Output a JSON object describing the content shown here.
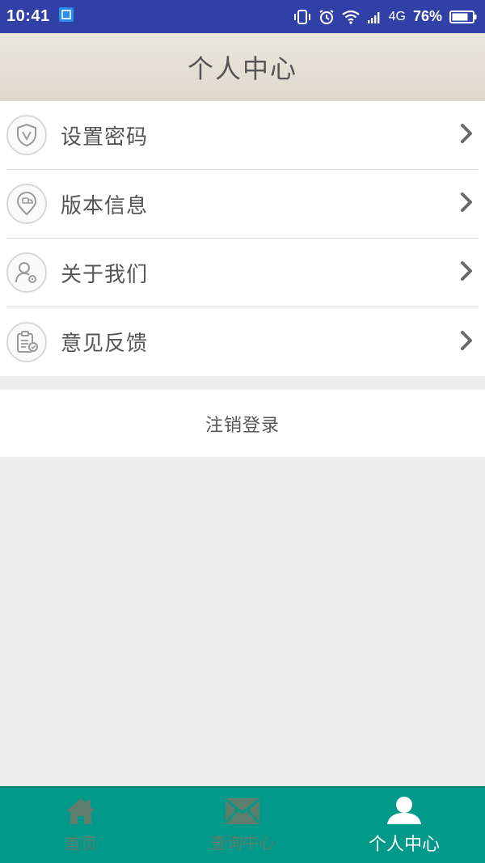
{
  "status_bar": {
    "time": "10:41",
    "network": "4G",
    "battery": "76%"
  },
  "header": {
    "title": "个人中心"
  },
  "menu": {
    "items": [
      {
        "label": "设置密码",
        "icon": "shield-icon"
      },
      {
        "label": "版本信息",
        "icon": "location-pin-icon"
      },
      {
        "label": "关于我们",
        "icon": "user-settings-icon"
      },
      {
        "label": "意见反馈",
        "icon": "clipboard-icon"
      }
    ]
  },
  "logout": {
    "label": "注销登录"
  },
  "tabbar": {
    "tabs": [
      {
        "label": "首页",
        "icon": "home-icon",
        "active": false
      },
      {
        "label": "查询中心",
        "icon": "envelope-icon",
        "active": false
      },
      {
        "label": "个人中心",
        "icon": "person-icon",
        "active": true
      }
    ]
  },
  "colors": {
    "status_bar_bg": "#3040a6",
    "header_bg": "#e4ded4",
    "tabbar_bg": "#00998a",
    "tab_inactive": "#5e7d6d",
    "tab_active": "#ffffff",
    "text": "#555555"
  }
}
